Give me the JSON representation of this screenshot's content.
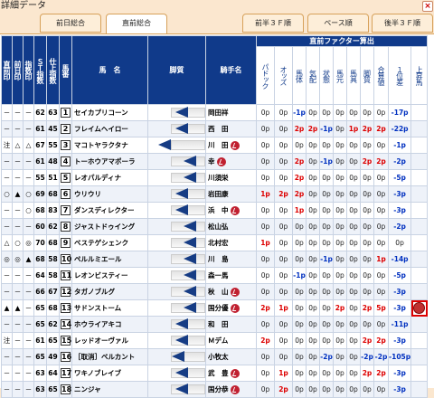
{
  "window": {
    "title": "詳細データ",
    "close": "×"
  },
  "tabs": [
    "前日総合",
    "直前総合",
    "前半３Ｆ順",
    "ペース順",
    "後半３Ｆ順"
  ],
  "active_tab": 1,
  "headers": {
    "chokuzen": "直前印",
    "zenjitsu": "前日印",
    "shisu": "指数印",
    "st": "ＳＴ指数",
    "shiage": "仕上指数",
    "umaban": "馬番",
    "bamei": "馬　名",
    "kyakushitsu": "脚質",
    "kishu": "騎手名",
    "factor_group": "直前ファクター算出",
    "factors": [
      "パドック",
      "オッズ",
      "馬体",
      "気配",
      "状態",
      "馬元",
      "馬具",
      "脚質",
      "合算値",
      "１位差",
      "上昇馬"
    ]
  },
  "rows": [
    {
      "m1": "－",
      "m2": "－",
      "m3": "－",
      "st": "62",
      "sh": "63",
      "no": "1",
      "name": "セイカプリコーン",
      "jockey": "岡田祥",
      "jm": false,
      "f": [
        "0p",
        "0p",
        "-1p",
        "0p",
        "0p",
        "0p",
        "0p",
        "0p",
        "0p",
        "-17p",
        ""
      ]
    },
    {
      "m1": "－",
      "m2": "－",
      "m3": "－",
      "st": "61",
      "sh": "45",
      "no": "2",
      "name": "フレイムヘイロー",
      "jockey": "西　田",
      "jm": false,
      "f": [
        "0p",
        "0p",
        "2p",
        "2p",
        "-1p",
        "0p",
        "1p",
        "2p",
        "2p",
        "-22p",
        ""
      ]
    },
    {
      "m1": "注",
      "m2": "△",
      "m3": "△",
      "st": "67",
      "sh": "55",
      "no": "3",
      "name": "マコトヤラクタナ",
      "jockey": "川　田",
      "jm": true,
      "f": [
        "0p",
        "0p",
        "0p",
        "0p",
        "0p",
        "0p",
        "0p",
        "0p",
        "0p",
        "-1p",
        ""
      ]
    },
    {
      "m1": "－",
      "m2": "－",
      "m3": "－",
      "st": "61",
      "sh": "48",
      "no": "4",
      "name": "トーホウアマポーラ",
      "jockey": "幸",
      "jm": true,
      "f": [
        "0p",
        "0p",
        "2p",
        "0p",
        "-1p",
        "0p",
        "0p",
        "2p",
        "2p",
        "-2p",
        ""
      ]
    },
    {
      "m1": "－",
      "m2": "－",
      "m3": "－",
      "st": "55",
      "sh": "51",
      "no": "5",
      "name": "レオパルディナ",
      "jockey": "川須栄",
      "jm": false,
      "f": [
        "0p",
        "0p",
        "2p",
        "0p",
        "0p",
        "0p",
        "0p",
        "0p",
        "0p",
        "-5p",
        ""
      ]
    },
    {
      "m1": "○",
      "m2": "▲",
      "m3": "○",
      "st": "69",
      "sh": "68",
      "no": "6",
      "name": "ウリウリ",
      "jockey": "岩田康",
      "jm": false,
      "f": [
        "1p",
        "2p",
        "2p",
        "0p",
        "0p",
        "0p",
        "0p",
        "0p",
        "0p",
        "-3p",
        ""
      ]
    },
    {
      "m1": "－",
      "m2": "－",
      "m3": "○",
      "st": "68",
      "sh": "83",
      "no": "7",
      "name": "ダンスディレクター",
      "jockey": "浜　中",
      "jm": true,
      "f": [
        "0p",
        "0p",
        "1p",
        "0p",
        "0p",
        "0p",
        "0p",
        "0p",
        "0p",
        "-3p",
        ""
      ]
    },
    {
      "m1": "－",
      "m2": "－",
      "m3": "－",
      "st": "60",
      "sh": "62",
      "no": "8",
      "name": "ジャストドゥイング",
      "jockey": "松山弘",
      "jm": false,
      "f": [
        "0p",
        "0p",
        "0p",
        "0p",
        "0p",
        "0p",
        "0p",
        "0p",
        "0p",
        "-2p",
        ""
      ]
    },
    {
      "m1": "△",
      "m2": "○",
      "m3": "◎",
      "st": "70",
      "sh": "68",
      "no": "9",
      "name": "ベステゲシェンク",
      "jockey": "北村宏",
      "jm": false,
      "f": [
        "1p",
        "0p",
        "0p",
        "0p",
        "0p",
        "0p",
        "0p",
        "0p",
        "0p",
        "0p",
        ""
      ]
    },
    {
      "m1": "◎",
      "m2": "◎",
      "m3": "▲",
      "st": "68",
      "sh": "58",
      "no": "10",
      "name": "ペルルミエール",
      "jockey": "川　島",
      "jm": false,
      "f": [
        "0p",
        "0p",
        "0p",
        "0p",
        "-1p",
        "0p",
        "0p",
        "0p",
        "1p",
        "-14p",
        ""
      ]
    },
    {
      "m1": "－",
      "m2": "－",
      "m3": "－",
      "st": "64",
      "sh": "58",
      "no": "11",
      "name": "レオンビスティー",
      "jockey": "森一馬",
      "jm": false,
      "f": [
        "0p",
        "0p",
        "-1p",
        "0p",
        "0p",
        "0p",
        "0p",
        "0p",
        "0p",
        "-5p",
        ""
      ]
    },
    {
      "m1": "－",
      "m2": "－",
      "m3": "－",
      "st": "66",
      "sh": "67",
      "no": "12",
      "name": "タガノブルグ",
      "jockey": "秋　山",
      "jm": true,
      "f": [
        "0p",
        "0p",
        "0p",
        "0p",
        "0p",
        "0p",
        "0p",
        "0p",
        "0p",
        "-3p",
        ""
      ]
    },
    {
      "m1": "▲",
      "m2": "▲",
      "m3": "－",
      "st": "65",
      "sh": "68",
      "no": "13",
      "name": "サドンストーム",
      "jockey": "国分優",
      "jm": true,
      "f": [
        "2p",
        "1p",
        "0p",
        "0p",
        "0p",
        "2p",
        "0p",
        "2p",
        "5p",
        "-3p",
        "pen"
      ]
    },
    {
      "m1": "－",
      "m2": "－",
      "m3": "－",
      "st": "65",
      "sh": "62",
      "no": "14",
      "name": "ホウライアキコ",
      "jockey": "和　田",
      "jm": false,
      "f": [
        "0p",
        "0p",
        "0p",
        "0p",
        "0p",
        "0p",
        "0p",
        "0p",
        "0p",
        "-11p",
        ""
      ]
    },
    {
      "m1": "注",
      "m2": "－",
      "m3": "－",
      "st": "61",
      "sh": "65",
      "no": "15",
      "name": "レッドオーヴァル",
      "jockey": "Ｍデム",
      "jm": false,
      "f": [
        "2p",
        "0p",
        "0p",
        "0p",
        "0p",
        "0p",
        "0p",
        "2p",
        "2p",
        "-3p",
        ""
      ]
    },
    {
      "m1": "－",
      "m2": "－",
      "m3": "－",
      "st": "65",
      "sh": "49",
      "no": "16",
      "name": "［取消］ベルカント",
      "jockey": "小牧太",
      "jm": false,
      "f": [
        "0p",
        "0p",
        "0p",
        "0p",
        "-2p",
        "0p",
        "0p",
        "-2p",
        "-2p",
        "-105p",
        ""
      ]
    },
    {
      "m1": "－",
      "m2": "－",
      "m3": "－",
      "st": "63",
      "sh": "64",
      "no": "17",
      "name": "ワキノブレイブ",
      "jockey": "武　豊",
      "jm": true,
      "f": [
        "0p",
        "1p",
        "0p",
        "0p",
        "0p",
        "0p",
        "0p",
        "2p",
        "2p",
        "-3p",
        ""
      ]
    },
    {
      "m1": "－",
      "m2": "－",
      "m3": "－",
      "st": "63",
      "sh": "65",
      "no": "18",
      "name": "ニンジャ",
      "jockey": "国分恭",
      "jm": true,
      "f": [
        "0p",
        "2p",
        "0p",
        "0p",
        "0p",
        "0p",
        "0p",
        "0p",
        "0p",
        "-3p",
        ""
      ]
    }
  ],
  "legs": [
    0.55,
    0.55,
    0.25,
    0.7,
    0.7,
    0.55,
    0.55,
    0.7,
    0.7,
    0.7,
    0.7,
    0.7,
    0.7,
    0.55,
    0.55,
    0.5,
    0.55,
    0.55
  ]
}
